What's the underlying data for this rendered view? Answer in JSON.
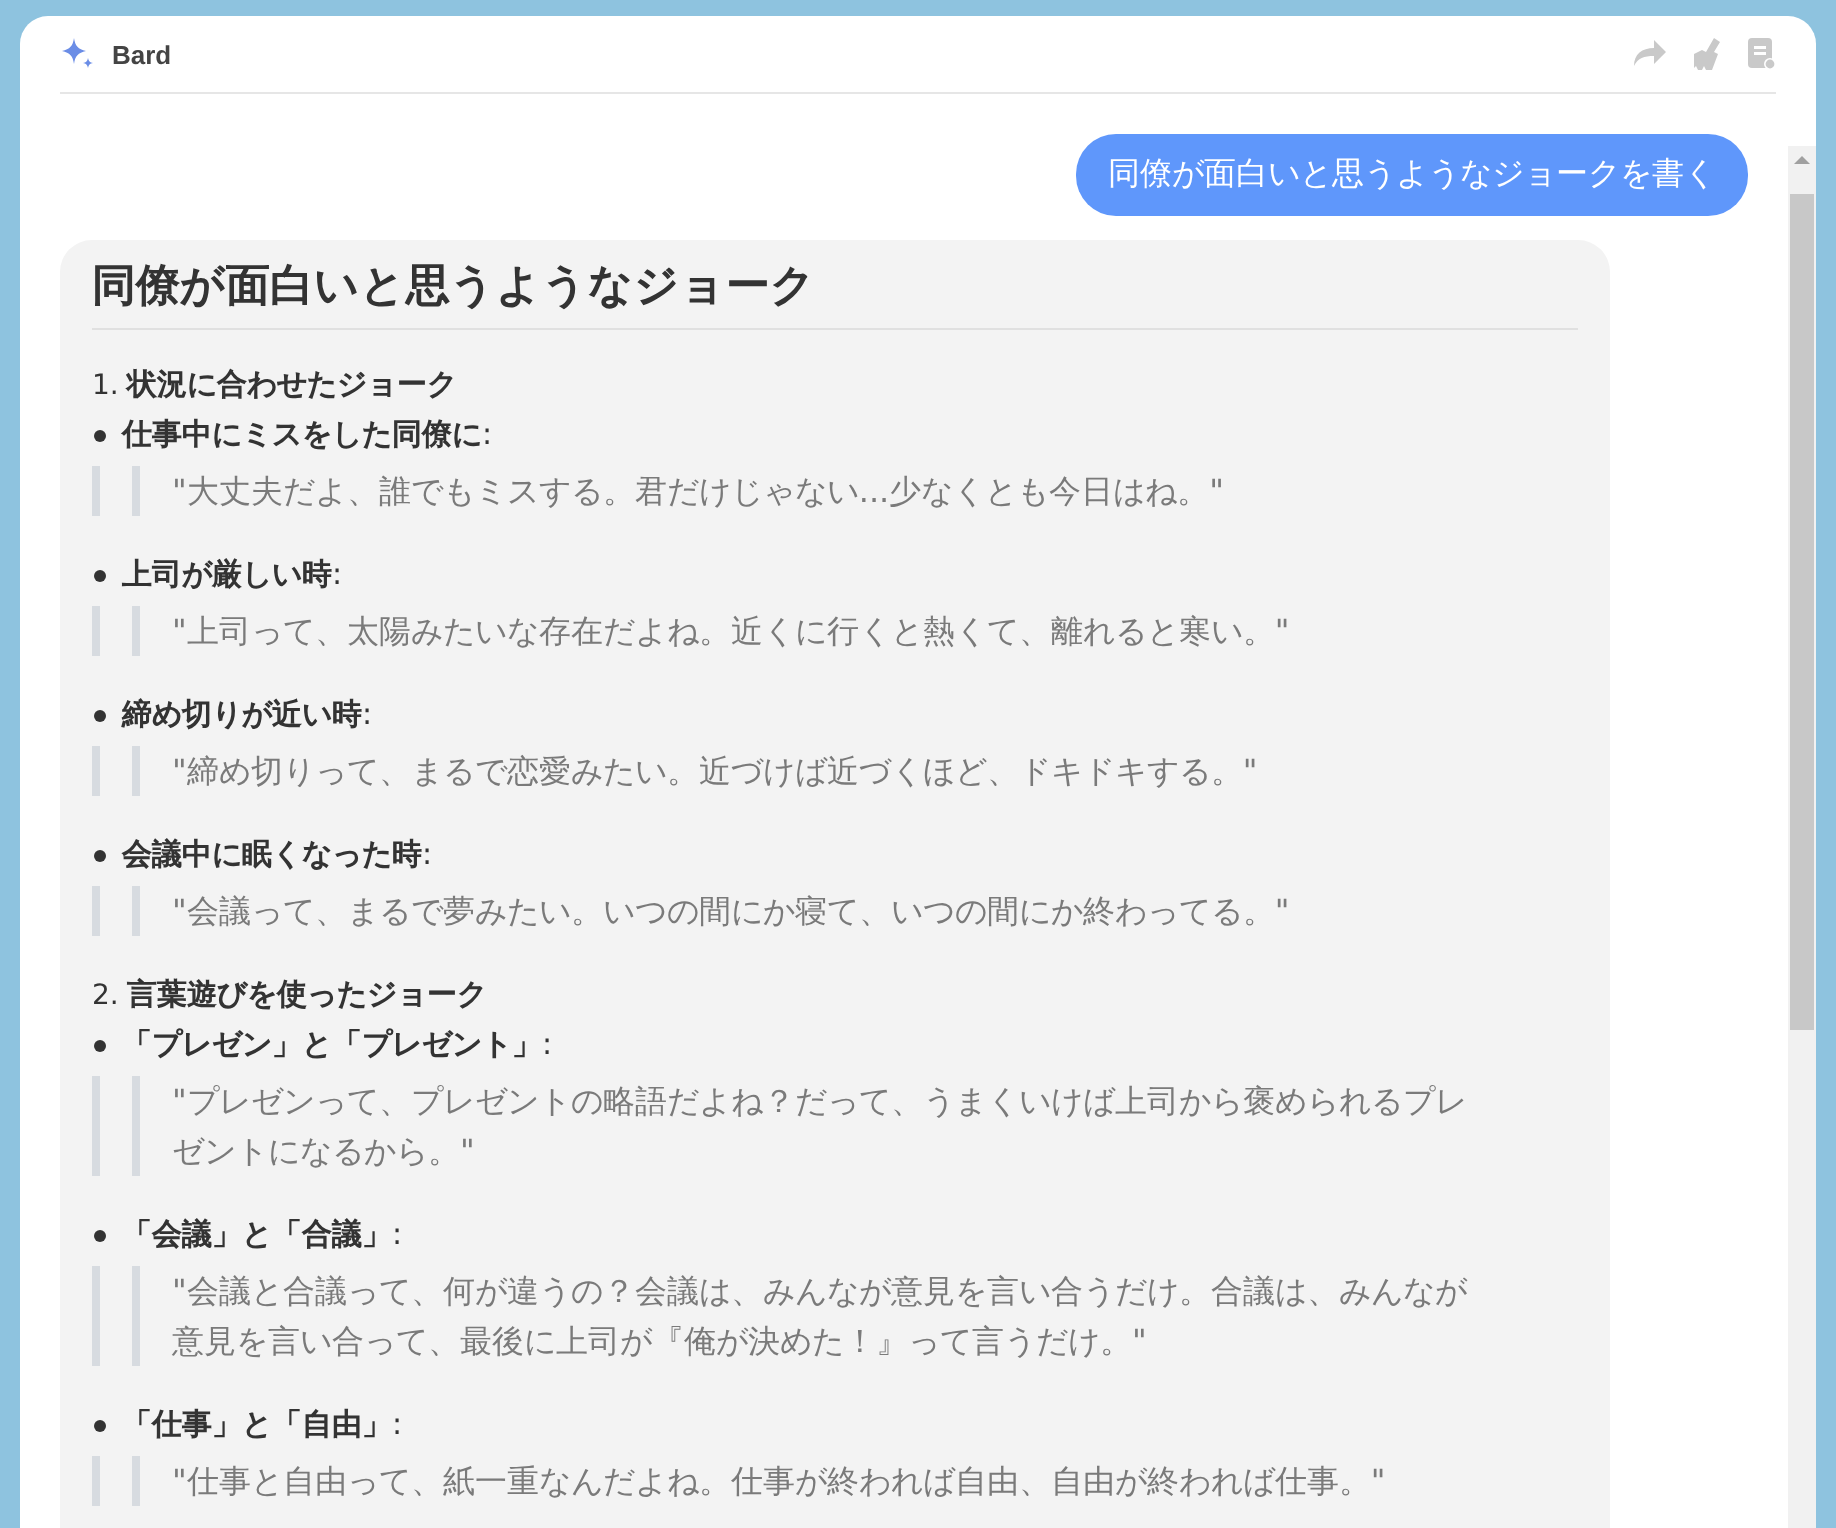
{
  "window": {
    "title": "Bard"
  },
  "user_message": "同僚が面白いと思うようなジョークを書く",
  "answer": {
    "title": "同僚が面白いと思うようなジョーク",
    "sections": [
      {
        "number": "1.",
        "title": "状況に合わせたジョーク",
        "items": [
          {
            "label": "**仕事中にミスをした同僚に**:",
            "quote": "\"大丈夫だよ、誰でもミスする。君だけじゃない...少なくとも今日はね。\""
          },
          {
            "label": "**上司が厳しい時**:",
            "quote": "\"上司って、太陽みたいな存在だよね。近くに行くと熱くて、離れると寒い。\""
          },
          {
            "label": "**締め切りが近い時**:",
            "quote": "\"締め切りって、まるで恋愛みたい。近づけば近づくほど、ドキドキする。\""
          },
          {
            "label": "**会議中に眠くなった時**:",
            "quote": "\"会議って、まるで夢みたい。いつの間にか寝て、いつの間にか終わってる。\""
          }
        ]
      },
      {
        "number": "2.",
        "title": "言葉遊びを使ったジョーク",
        "items": [
          {
            "label": "**「プレゼン」と「プレゼント」**:",
            "quote": "\"プレゼンって、プレゼントの略語だよね？だって、うまくいけば上司から褒められるプレゼントになるから。\""
          },
          {
            "label": "**「会議」と「合議」**:",
            "quote": "\"会議と合議って、何が違うの？会議は、みんなが意見を言い合うだけ。合議は、みんなが意見を言い合って、最後に上司が『俺が決めた！』って言うだけ。\""
          },
          {
            "label": "**「仕事」と「自由」**:",
            "quote": "\"仕事と自由って、紙一重なんだよね。仕事が終われば自由、自由が終われば仕事。\""
          }
        ]
      }
    ]
  }
}
